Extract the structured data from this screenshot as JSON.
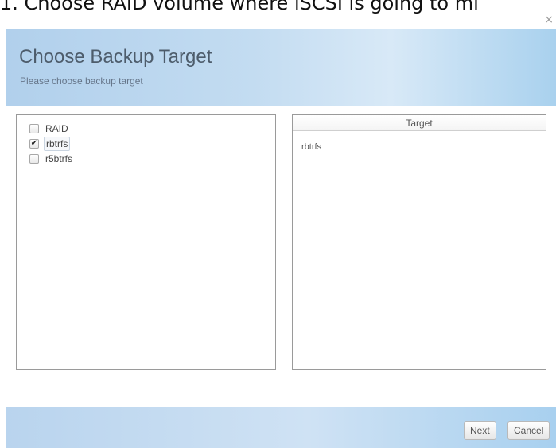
{
  "instruction": "1. Choose RAID volume where iSCSI is going to mi",
  "dialog": {
    "close_glyph": "×",
    "title": "Choose Backup Target",
    "subtitle": "Please choose backup target",
    "tree_items": [
      {
        "label": "RAID",
        "checked": false
      },
      {
        "label": "rbtrfs",
        "checked": true
      },
      {
        "label": "r5btrfs",
        "checked": false
      }
    ],
    "target_header": "Target",
    "target_items": [
      "rbtrfs"
    ],
    "buttons": {
      "next": "Next",
      "cancel": "Cancel"
    }
  },
  "colors": {
    "header_gradient_start": "#b1d0ec",
    "footer_gradient_start": "#b9d4ee",
    "title_text": "#4d5c6b"
  },
  "icons": {
    "close": "close-icon",
    "checkbox": "checkbox-icon",
    "check": "check-icon"
  }
}
